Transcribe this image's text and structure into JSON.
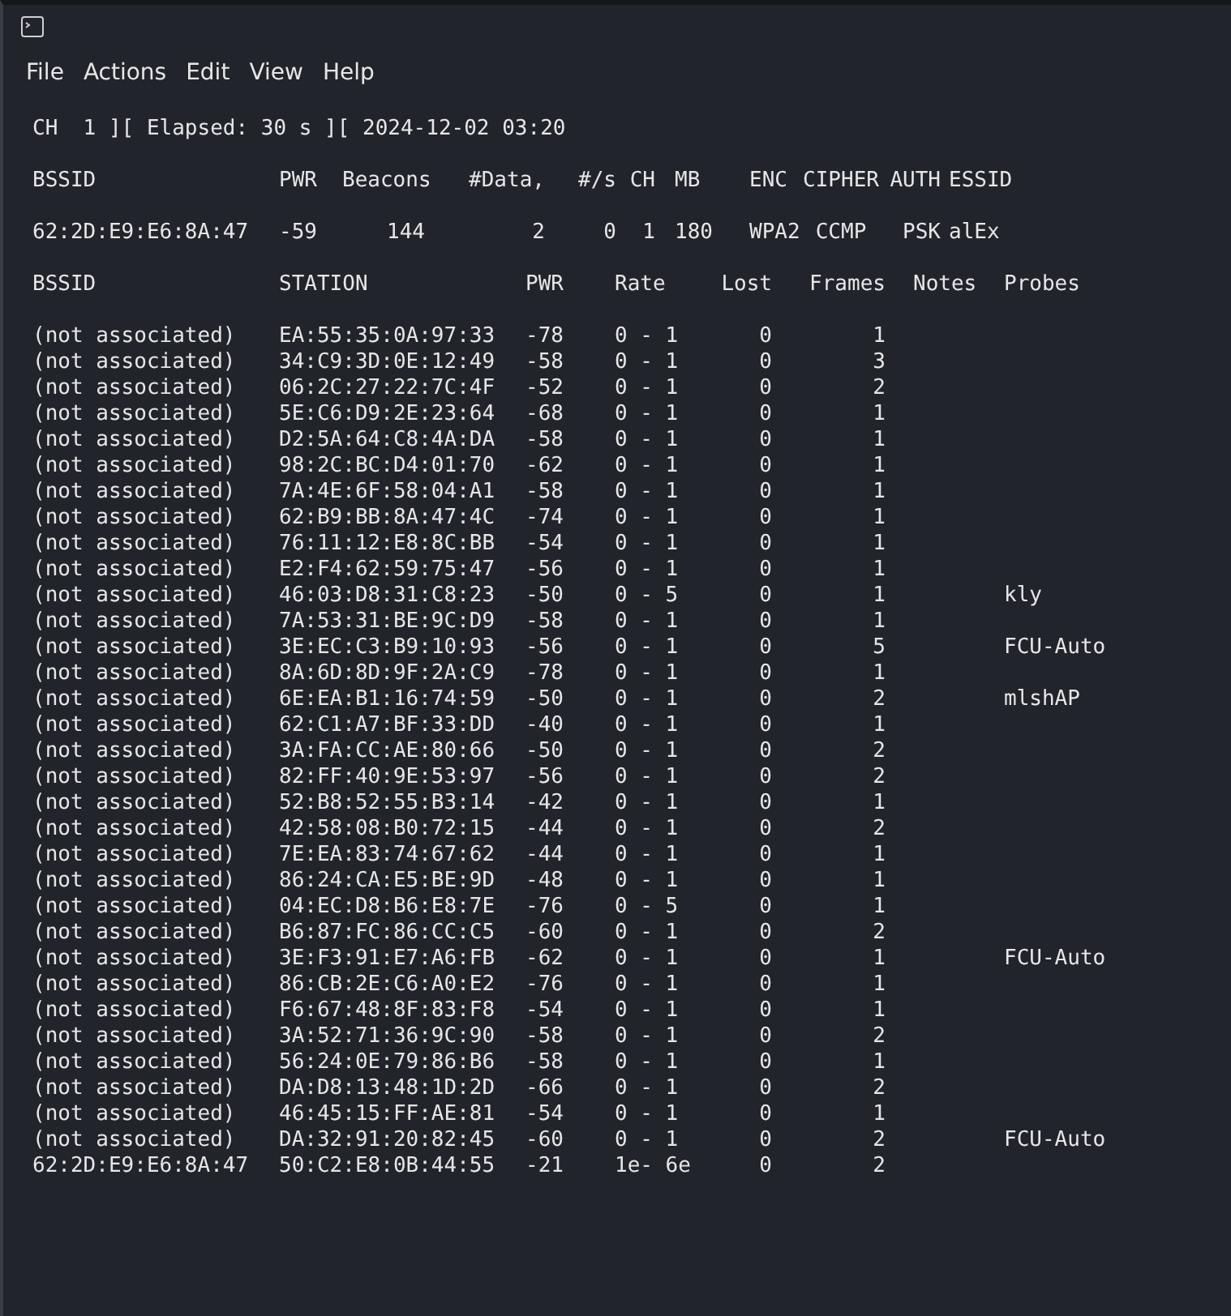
{
  "menu": [
    "File",
    "Actions",
    "Edit",
    "View",
    "Help"
  ],
  "status_line": "CH  1 ][ Elapsed: 30 s ][ 2024-12-02 03:20",
  "access_points": {
    "columns": [
      "BSSID",
      "PWR",
      "Beacons",
      "#Data,",
      "#/s",
      "CH",
      "MB",
      "ENC",
      "CIPHER",
      "AUTH",
      "ESSID"
    ],
    "rows": [
      [
        "62:2D:E9:E6:8A:47",
        "-59",
        "144",
        "2",
        "0",
        "1",
        "180",
        "WPA2",
        "CCMP",
        "PSK",
        "alEx"
      ]
    ]
  },
  "stations": {
    "columns": [
      "BSSID",
      "STATION",
      "PWR",
      "Rate",
      "Lost",
      "Frames",
      "Notes",
      "Probes"
    ],
    "rows": [
      {
        "bssid": "(not associated)",
        "station": "EA:55:35:0A:97:33",
        "pwr": "-78",
        "rate": "0 - 1",
        "lost": "0",
        "frames": "1"
      },
      {
        "bssid": "(not associated)",
        "station": "34:C9:3D:0E:12:49",
        "pwr": "-58",
        "rate": "0 - 1",
        "lost": "0",
        "frames": "3"
      },
      {
        "bssid": "(not associated)",
        "station": "06:2C:27:22:7C:4F",
        "pwr": "-52",
        "rate": "0 - 1",
        "lost": "0",
        "frames": "2"
      },
      {
        "bssid": "(not associated)",
        "station": "5E:C6:D9:2E:23:64",
        "pwr": "-68",
        "rate": "0 - 1",
        "lost": "0",
        "frames": "1"
      },
      {
        "bssid": "(not associated)",
        "station": "D2:5A:64:C8:4A:DA",
        "pwr": "-58",
        "rate": "0 - 1",
        "lost": "0",
        "frames": "1"
      },
      {
        "bssid": "(not associated)",
        "station": "98:2C:BC:D4:01:70",
        "pwr": "-62",
        "rate": "0 - 1",
        "lost": "0",
        "frames": "1"
      },
      {
        "bssid": "(not associated)",
        "station": "7A:4E:6F:58:04:A1",
        "pwr": "-58",
        "rate": "0 - 1",
        "lost": "0",
        "frames": "1"
      },
      {
        "bssid": "(not associated)",
        "station": "62:B9:BB:8A:47:4C",
        "pwr": "-74",
        "rate": "0 - 1",
        "lost": "0",
        "frames": "1"
      },
      {
        "bssid": "(not associated)",
        "station": "76:11:12:E8:8C:BB",
        "pwr": "-54",
        "rate": "0 - 1",
        "lost": "0",
        "frames": "1"
      },
      {
        "bssid": "(not associated)",
        "station": "E2:F4:62:59:75:47",
        "pwr": "-56",
        "rate": "0 - 1",
        "lost": "0",
        "frames": "1"
      },
      {
        "bssid": "(not associated)",
        "station": "46:03:D8:31:C8:23",
        "pwr": "-50",
        "rate": "0 - 5",
        "lost": "0",
        "frames": "1",
        "probes": "kly"
      },
      {
        "bssid": "(not associated)",
        "station": "7A:53:31:BE:9C:D9",
        "pwr": "-58",
        "rate": "0 - 1",
        "lost": "0",
        "frames": "1"
      },
      {
        "bssid": "(not associated)",
        "station": "3E:EC:C3:B9:10:93",
        "pwr": "-56",
        "rate": "0 - 1",
        "lost": "0",
        "frames": "5",
        "probes": "FCU-Auto"
      },
      {
        "bssid": "(not associated)",
        "station": "8A:6D:8D:9F:2A:C9",
        "pwr": "-78",
        "rate": "0 - 1",
        "lost": "0",
        "frames": "1"
      },
      {
        "bssid": "(not associated)",
        "station": "6E:EA:B1:16:74:59",
        "pwr": "-50",
        "rate": "0 - 1",
        "lost": "0",
        "frames": "2",
        "probes": "mlshAP"
      },
      {
        "bssid": "(not associated)",
        "station": "62:C1:A7:BF:33:DD",
        "pwr": "-40",
        "rate": "0 - 1",
        "lost": "0",
        "frames": "1"
      },
      {
        "bssid": "(not associated)",
        "station": "3A:FA:CC:AE:80:66",
        "pwr": "-50",
        "rate": "0 - 1",
        "lost": "0",
        "frames": "2"
      },
      {
        "bssid": "(not associated)",
        "station": "82:FF:40:9E:53:97",
        "pwr": "-56",
        "rate": "0 - 1",
        "lost": "0",
        "frames": "2"
      },
      {
        "bssid": "(not associated)",
        "station": "52:B8:52:55:B3:14",
        "pwr": "-42",
        "rate": "0 - 1",
        "lost": "0",
        "frames": "1"
      },
      {
        "bssid": "(not associated)",
        "station": "42:58:08:B0:72:15",
        "pwr": "-44",
        "rate": "0 - 1",
        "lost": "0",
        "frames": "2"
      },
      {
        "bssid": "(not associated)",
        "station": "7E:EA:83:74:67:62",
        "pwr": "-44",
        "rate": "0 - 1",
        "lost": "0",
        "frames": "1"
      },
      {
        "bssid": "(not associated)",
        "station": "86:24:CA:E5:BE:9D",
        "pwr": "-48",
        "rate": "0 - 1",
        "lost": "0",
        "frames": "1"
      },
      {
        "bssid": "(not associated)",
        "station": "04:EC:D8:B6:E8:7E",
        "pwr": "-76",
        "rate": "0 - 5",
        "lost": "0",
        "frames": "1"
      },
      {
        "bssid": "(not associated)",
        "station": "B6:87:FC:86:CC:C5",
        "pwr": "-60",
        "rate": "0 - 1",
        "lost": "0",
        "frames": "2"
      },
      {
        "bssid": "(not associated)",
        "station": "3E:F3:91:E7:A6:FB",
        "pwr": "-62",
        "rate": "0 - 1",
        "lost": "0",
        "frames": "1",
        "probes": "FCU-Auto"
      },
      {
        "bssid": "(not associated)",
        "station": "86:CB:2E:C6:A0:E2",
        "pwr": "-76",
        "rate": "0 - 1",
        "lost": "0",
        "frames": "1"
      },
      {
        "bssid": "(not associated)",
        "station": "F6:67:48:8F:83:F8",
        "pwr": "-54",
        "rate": "0 - 1",
        "lost": "0",
        "frames": "1"
      },
      {
        "bssid": "(not associated)",
        "station": "3A:52:71:36:9C:90",
        "pwr": "-58",
        "rate": "0 - 1",
        "lost": "0",
        "frames": "2"
      },
      {
        "bssid": "(not associated)",
        "station": "56:24:0E:79:86:B6",
        "pwr": "-58",
        "rate": "0 - 1",
        "lost": "0",
        "frames": "1"
      },
      {
        "bssid": "(not associated)",
        "station": "DA:D8:13:48:1D:2D",
        "pwr": "-66",
        "rate": "0 - 1",
        "lost": "0",
        "frames": "2"
      },
      {
        "bssid": "(not associated)",
        "station": "46:45:15:FF:AE:81",
        "pwr": "-54",
        "rate": "0 - 1",
        "lost": "0",
        "frames": "1"
      },
      {
        "bssid": "(not associated)",
        "station": "DA:32:91:20:82:45",
        "pwr": "-60",
        "rate": "0 - 1",
        "lost": "0",
        "frames": "2",
        "probes": "FCU-Auto"
      },
      {
        "bssid": "62:2D:E9:E6:8A:47",
        "station": "50:C2:E8:0B:44:55",
        "pwr": "-21",
        "rate": "1e- 6e",
        "lost": "0",
        "frames": "2"
      }
    ]
  }
}
